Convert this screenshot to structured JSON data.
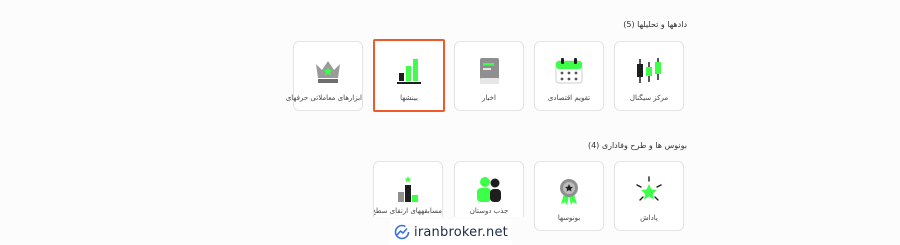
{
  "sections": [
    {
      "title": "دادهها و تحلیلها (5)",
      "tiles": [
        {
          "label": "مرکز سیگنال",
          "icon": "candlestick-icon"
        },
        {
          "label": "تقویم اقتصادی",
          "icon": "calendar-icon"
        },
        {
          "label": "اخبار",
          "icon": "news-icon"
        },
        {
          "label": "بینشها",
          "icon": "bar-chart-icon",
          "active": true
        },
        {
          "label": "ابزارهای معاملاتی حرفهای",
          "icon": "crown-icon"
        }
      ]
    },
    {
      "title": "بونوس ها و طرح وفاداری (4)",
      "tiles": [
        {
          "label": "پاداش",
          "icon": "star-burst-icon"
        },
        {
          "label": "بونوسها",
          "icon": "medal-icon"
        },
        {
          "label": "جذب دوستان",
          "icon": "users-icon"
        },
        {
          "label": "مسابقههای ارتقای سطح",
          "icon": "podium-icon"
        }
      ]
    }
  ],
  "watermark": {
    "text": "iranbroker.net"
  },
  "colors": {
    "accent": "#3dff4a",
    "dark": "#1e1e1e",
    "highlight": "#ef5a2a",
    "brand": "#3b6fe0"
  }
}
